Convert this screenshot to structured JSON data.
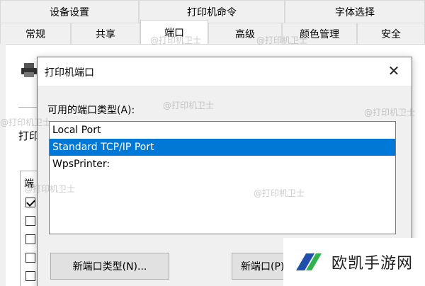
{
  "tabs": {
    "row1": [
      "设备设置",
      "打印机命令",
      "字体选择"
    ],
    "row2": [
      "常规",
      "共享",
      "端口",
      "高级",
      "颜色管理",
      "安全"
    ],
    "active": "端口"
  },
  "background_page": {
    "print_fragment": "打印",
    "port_fragment": "端"
  },
  "dialog": {
    "title": "打印机端口",
    "close_glyph": "✕",
    "available_label": "可用的端口类型(A):",
    "port_types": [
      "Local Port",
      "Standard TCP/IP Port",
      "WpsPrinter:"
    ],
    "selected_port": "Standard TCP/IP Port",
    "buttons": {
      "new_port_type": "新端口类型(N)...",
      "new_port": "新端口(P)..."
    }
  },
  "watermark": "@打印机卫士",
  "logo": {
    "text": "欧凯手游网",
    "color_dark": "#1f4fa8",
    "color_green": "#2fb34a"
  },
  "colors": {
    "selection": "#0078d7",
    "button_bg": "#e1e1e1"
  }
}
